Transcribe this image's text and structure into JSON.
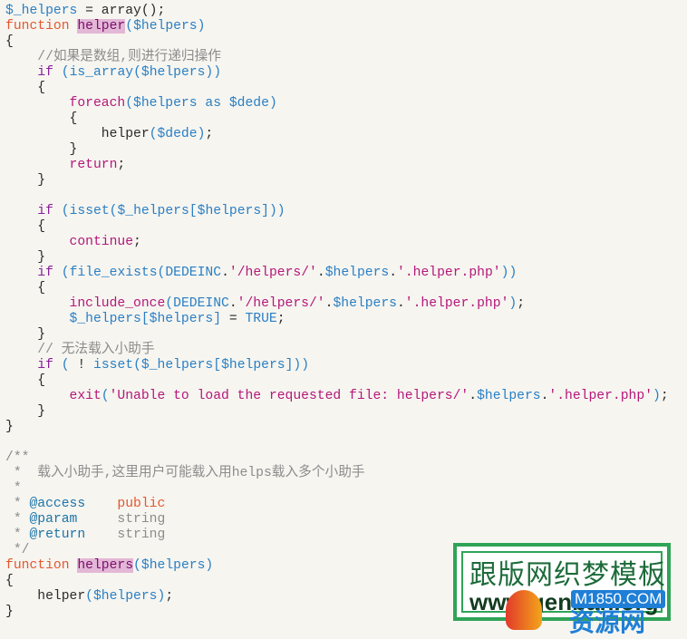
{
  "editor": {
    "language": "php",
    "background": "#f6f5f0"
  },
  "lines": [
    [
      [
        "v",
        "$_helpers"
      ],
      [
        "p",
        " = array();"
      ]
    ],
    [
      [
        "k",
        "function"
      ],
      [
        "p",
        " "
      ],
      [
        "h",
        "helper"
      ],
      [
        "o",
        "("
      ],
      [
        "v",
        "$helpers"
      ],
      [
        "o",
        ")"
      ]
    ],
    [
      [
        "p",
        "{"
      ]
    ],
    [
      [
        "p",
        "    "
      ],
      [
        "m",
        "//如果是数组,则进行递归操作"
      ]
    ],
    [
      [
        "p",
        "    "
      ],
      [
        "c",
        "if"
      ],
      [
        "p",
        " "
      ],
      [
        "o",
        "("
      ],
      [
        "v",
        "is_array"
      ],
      [
        "o",
        "("
      ],
      [
        "v",
        "$helpers"
      ],
      [
        "o",
        "))"
      ]
    ],
    [
      [
        "p",
        "    {"
      ]
    ],
    [
      [
        "p",
        "        "
      ],
      [
        "s",
        "foreach"
      ],
      [
        "o",
        "("
      ],
      [
        "v",
        "$helpers"
      ],
      [
        "p",
        " "
      ],
      [
        "v",
        "as"
      ],
      [
        "p",
        " "
      ],
      [
        "v",
        "$dede"
      ],
      [
        "o",
        ")"
      ]
    ],
    [
      [
        "p",
        "        {"
      ]
    ],
    [
      [
        "p",
        "            helper"
      ],
      [
        "o",
        "("
      ],
      [
        "v",
        "$dede"
      ],
      [
        "o",
        ")"
      ],
      [
        "p",
        ";"
      ]
    ],
    [
      [
        "p",
        "        }"
      ]
    ],
    [
      [
        "p",
        "        "
      ],
      [
        "s",
        "return"
      ],
      [
        "p",
        ";"
      ]
    ],
    [
      [
        "p",
        "    }"
      ]
    ],
    [
      [
        "p",
        ""
      ]
    ],
    [
      [
        "p",
        "    "
      ],
      [
        "c",
        "if"
      ],
      [
        "p",
        " "
      ],
      [
        "o",
        "("
      ],
      [
        "v",
        "isset"
      ],
      [
        "o",
        "("
      ],
      [
        "v",
        "$_helpers"
      ],
      [
        "o",
        "["
      ],
      [
        "v",
        "$helpers"
      ],
      [
        "o",
        "]))"
      ]
    ],
    [
      [
        "p",
        "    {"
      ]
    ],
    [
      [
        "p",
        "        "
      ],
      [
        "s",
        "continue"
      ],
      [
        "p",
        ";"
      ]
    ],
    [
      [
        "p",
        "    }"
      ]
    ],
    [
      [
        "p",
        "    "
      ],
      [
        "c",
        "if"
      ],
      [
        "p",
        " "
      ],
      [
        "o",
        "("
      ],
      [
        "v",
        "file_exists"
      ],
      [
        "o",
        "("
      ],
      [
        "v",
        "DEDEINC"
      ],
      [
        "p",
        "."
      ],
      [
        "s",
        "'/helpers/'"
      ],
      [
        "p",
        "."
      ],
      [
        "v",
        "$helpers"
      ],
      [
        "p",
        "."
      ],
      [
        "s",
        "'.helper.php'"
      ],
      [
        "o",
        "))"
      ]
    ],
    [
      [
        "p",
        "    {"
      ]
    ],
    [
      [
        "p",
        "        "
      ],
      [
        "s",
        "include_once"
      ],
      [
        "o",
        "("
      ],
      [
        "v",
        "DEDEINC"
      ],
      [
        "p",
        "."
      ],
      [
        "s",
        "'/helpers/'"
      ],
      [
        "p",
        "."
      ],
      [
        "v",
        "$helpers"
      ],
      [
        "p",
        "."
      ],
      [
        "s",
        "'.helper.php'"
      ],
      [
        "o",
        ")"
      ],
      [
        "p",
        ";"
      ]
    ],
    [
      [
        "p",
        "        "
      ],
      [
        "v",
        "$_helpers"
      ],
      [
        "o",
        "["
      ],
      [
        "v",
        "$helpers"
      ],
      [
        "o",
        "]"
      ],
      [
        "p",
        " = "
      ],
      [
        "v",
        "TRUE"
      ],
      [
        "p",
        ";"
      ]
    ],
    [
      [
        "p",
        "    }"
      ]
    ],
    [
      [
        "p",
        "    "
      ],
      [
        "m",
        "// 无法载入小助手"
      ]
    ],
    [
      [
        "p",
        "    "
      ],
      [
        "c",
        "if"
      ],
      [
        "p",
        " "
      ],
      [
        "o",
        "("
      ],
      [
        "p",
        " ! "
      ],
      [
        "v",
        "isset"
      ],
      [
        "o",
        "("
      ],
      [
        "v",
        "$_helpers"
      ],
      [
        "o",
        "["
      ],
      [
        "v",
        "$helpers"
      ],
      [
        "o",
        "]))"
      ]
    ],
    [
      [
        "p",
        "    {"
      ]
    ],
    [
      [
        "p",
        "        "
      ],
      [
        "s",
        "exit"
      ],
      [
        "o",
        "("
      ],
      [
        "s",
        "'Unable to load the requested file: helpers/'"
      ],
      [
        "p",
        "."
      ],
      [
        "v",
        "$helpers"
      ],
      [
        "p",
        "."
      ],
      [
        "s",
        "'.helper.php'"
      ],
      [
        "o",
        ")"
      ],
      [
        "p",
        ";"
      ]
    ],
    [
      [
        "p",
        "    }"
      ]
    ],
    [
      [
        "p",
        "}"
      ]
    ],
    [
      [
        "p",
        ""
      ]
    ],
    [
      [
        "g",
        "/**"
      ]
    ],
    [
      [
        "g",
        " *  载入小助手,这里用户可能载入用helps载入多个小助手"
      ]
    ],
    [
      [
        "g",
        " *"
      ]
    ],
    [
      [
        "g",
        " * "
      ],
      [
        "d",
        "@access"
      ],
      [
        "g",
        "    "
      ],
      [
        "e",
        "public"
      ]
    ],
    [
      [
        "g",
        " * "
      ],
      [
        "d",
        "@param"
      ],
      [
        "g",
        "     string"
      ]
    ],
    [
      [
        "g",
        " * "
      ],
      [
        "d",
        "@return"
      ],
      [
        "g",
        "    string"
      ]
    ],
    [
      [
        "g",
        " */"
      ]
    ],
    [
      [
        "k",
        "function"
      ],
      [
        "p",
        " "
      ],
      [
        "h",
        "helpers"
      ],
      [
        "o",
        "("
      ],
      [
        "v",
        "$helpers"
      ],
      [
        "o",
        ")"
      ]
    ],
    [
      [
        "p",
        "{"
      ]
    ],
    [
      [
        "p",
        "    helper"
      ],
      [
        "o",
        "("
      ],
      [
        "v",
        "$helpers"
      ],
      [
        "o",
        ")"
      ],
      [
        "p",
        ";"
      ]
    ],
    [
      [
        "p",
        "}"
      ]
    ]
  ],
  "watermark": {
    "title": "跟版网织梦模板",
    "url": "www.genban.org",
    "badge": "M1850.COM",
    "brand": "资源网",
    "color": "#2fa457"
  }
}
